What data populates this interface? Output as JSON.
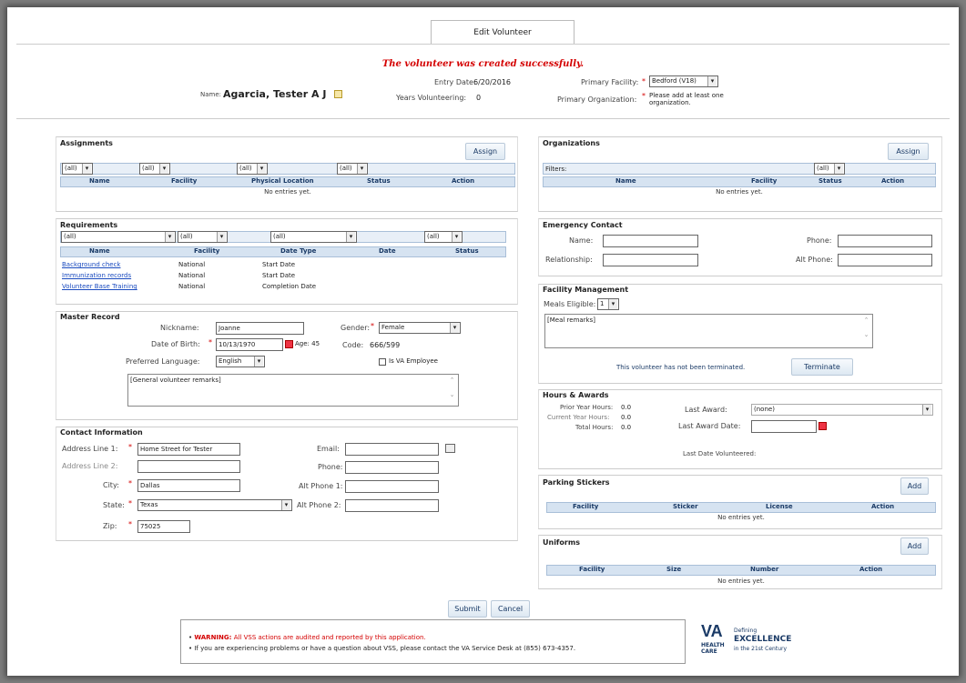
{
  "tab": {
    "label": "Edit Volunteer"
  },
  "success_message": "The volunteer was created successfully.",
  "header": {
    "name_label": "Name:",
    "name_value": "Agarcia, Tester A J",
    "entry_date_label": "Entry Date:",
    "entry_date_value": "6/20/2016",
    "years_label": "Years Volunteering:",
    "years_value": "0",
    "primary_facility_label": "Primary Facility:",
    "primary_facility_value": "Bedford (V18)",
    "primary_org_label": "Primary Organization:",
    "primary_org_value": "Please add at least one organization."
  },
  "assignments": {
    "title": "Assignments",
    "assign_btn": "Assign",
    "filter": "(all)",
    "columns": [
      "Name",
      "Facility",
      "Physical Location",
      "Status",
      "Action"
    ],
    "empty": "No entries yet."
  },
  "requirements": {
    "title": "Requirements",
    "filter": "(all)",
    "columns": [
      "Name",
      "Facility",
      "Date Type",
      "Date",
      "Status"
    ],
    "rows": [
      {
        "name": "Background check",
        "facility": "National",
        "date_type": "Start Date"
      },
      {
        "name": "Immunization records",
        "facility": "National",
        "date_type": "Start Date"
      },
      {
        "name": "Volunteer Base Training",
        "facility": "National",
        "date_type": "Completion Date"
      }
    ]
  },
  "master_record": {
    "title": "Master Record",
    "nickname_label": "Nickname:",
    "nickname_value": "Joanne",
    "gender_label": "Gender:",
    "gender_value": "Female",
    "dob_label": "Date of Birth:",
    "dob_value": "10/13/1970",
    "age_text": "Age: 45",
    "code_label": "Code:",
    "code_value": "666/599",
    "lang_label": "Preferred Language:",
    "lang_value": "English",
    "va_employee_label": "Is VA Employee",
    "remarks_placeholder": "[General volunteer remarks]"
  },
  "contact": {
    "title": "Contact Information",
    "addr1_label": "Address Line 1:",
    "addr1_value": "Home Street for Tester",
    "addr2_label": "Address Line 2:",
    "city_label": "City:",
    "city_value": "Dallas",
    "state_label": "State:",
    "state_value": "Texas",
    "zip_label": "Zip:",
    "zip_value": "75025",
    "email_label": "Email:",
    "phone_label": "Phone:",
    "alt1_label": "Alt Phone 1:",
    "alt2_label": "Alt Phone 2:"
  },
  "organizations": {
    "title": "Organizations",
    "assign_btn": "Assign",
    "filter_label": "Filters:",
    "filter": "(all)",
    "columns": [
      "Name",
      "Facility",
      "Status",
      "Action"
    ],
    "empty": "No entries yet."
  },
  "emergency": {
    "title": "Emergency Contact",
    "name_label": "Name:",
    "relationship_label": "Relationship:",
    "phone_label": "Phone:",
    "alt_phone_label": "Alt Phone:"
  },
  "facility_mgmt": {
    "title": "Facility Management",
    "meals_label": "Meals Eligible:",
    "meals_value": "1",
    "remarks_placeholder": "[Meal remarks]",
    "not_terminated": "This volunteer has not been terminated.",
    "terminate_btn": "Terminate"
  },
  "hours": {
    "title": "Hours & Awards",
    "prior_label": "Prior Year Hours:",
    "prior_value": "0.0",
    "current_label": "Current Year Hours:",
    "current_value": "0.0",
    "total_label": "Total Hours:",
    "total_value": "0.0",
    "last_award_label": "Last Award:",
    "last_award_value": "(none)",
    "last_award_date_label": "Last Award Date:",
    "last_vol_label": "Last Date Volunteered:"
  },
  "parking": {
    "title": "Parking Stickers",
    "add_btn": "Add",
    "columns": [
      "Facility",
      "Sticker",
      "License",
      "Action"
    ],
    "empty": "No entries yet."
  },
  "uniforms": {
    "title": "Uniforms",
    "add_btn": "Add",
    "columns": [
      "Facility",
      "Size",
      "Number",
      "Action"
    ],
    "empty": "No entries yet."
  },
  "actions": {
    "submit": "Submit",
    "cancel": "Cancel"
  },
  "footer": {
    "warning_label": "WARNING:",
    "warning_text": "All VSS actions are audited and reported by this application.",
    "help_text": "If you are experiencing problems or have a question about VSS, please contact the VA Service Desk at (855) 673-4357.",
    "logo_va": "VA",
    "logo_health": "HEALTH",
    "logo_care": "CARE",
    "logo_defining": "Defining",
    "logo_excellence": "EXCELLENCE",
    "logo_century": "in the 21st Century"
  },
  "colors": {
    "accent": "#1a3a66",
    "success": "#d40000",
    "header_bg": "#d6e3f1"
  }
}
